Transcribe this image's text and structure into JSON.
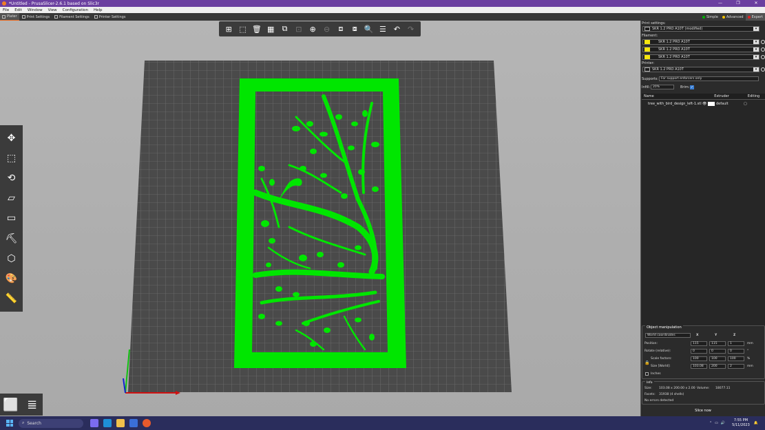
{
  "window": {
    "title": "*Untitled - PrusaSlicer-2.6.1 based on Slic3r",
    "controls": [
      "—",
      "❐",
      "✕"
    ]
  },
  "menu": [
    "File",
    "Edit",
    "Window",
    "View",
    "Configuration",
    "Help"
  ],
  "tabs": [
    {
      "label": "Plater",
      "active": true
    },
    {
      "label": "Print Settings"
    },
    {
      "label": "Filament Settings"
    },
    {
      "label": "Printer Settings"
    }
  ],
  "modes": [
    {
      "label": "Simple",
      "color": "#00b000"
    },
    {
      "label": "Advanced",
      "color": "#f0c000"
    },
    {
      "label": "Expert",
      "color": "#e02020"
    }
  ],
  "top_toolbar_icons": [
    "add-icon",
    "delete-icon",
    "delete-all-icon",
    "arrange-icon",
    "copy-icon",
    "paste-icon",
    "add-instance-icon",
    "remove-instance-icon",
    "split-objects-icon",
    "split-parts-icon",
    "search-icon",
    "layers-icon",
    "undo-icon",
    "redo-icon"
  ],
  "left_toolbar_icons": [
    "move-icon",
    "scale-icon",
    "rotate-icon",
    "place-on-face-icon",
    "cut-icon",
    "support-paint-icon",
    "seam-paint-icon",
    "mmu-paint-icon",
    "measure-icon"
  ],
  "sidebar": {
    "print_settings_label": "Print settings:",
    "print_profile": "SKR 1.2 PRO A10T (modified)",
    "filament_label": "Filament:",
    "filaments": [
      "SKR 1.2 PRO A10T",
      "SKR 1.2 PRO A10T",
      "SKR 1.2 PRO A10T"
    ],
    "filament_color": "#f6e60e",
    "printer_label": "Printer:",
    "printer_profile": "SKR 1.2 PRO A10T",
    "supports_label": "Supports:",
    "supports_value": "For support enforcers only",
    "infill_label": "Infill:",
    "infill_value": "20%",
    "brim_label": "Brim:",
    "object_list": {
      "headers": {
        "name": "Name",
        "extruder": "Extruder",
        "editing": "Editing"
      },
      "rows": [
        {
          "name": "tree_with_bird_design_left-1.stl",
          "extruder": "default"
        }
      ]
    },
    "object_manipulation": {
      "title": "Object manipulation",
      "coord_system": "World coordinates",
      "axes": [
        "X",
        "Y",
        "Z"
      ],
      "position_label": "Position:",
      "position": [
        "115",
        "115",
        "1"
      ],
      "position_unit": "mm",
      "rotate_label": "Rotate (relative):",
      "rotate": [
        "0",
        "0",
        "0"
      ],
      "rotate_unit": "°",
      "scale_label": "Scale factors:",
      "scale": [
        "100",
        "100",
        "100"
      ],
      "scale_unit": "%",
      "size_label": "Size [World]:",
      "size": [
        "103.08",
        "200",
        "2"
      ],
      "size_unit": "mm",
      "inches_label": "Inches"
    },
    "info": {
      "title": "Info",
      "size_label": "Size:",
      "size": "103.08 x 200.00 x 2.00",
      "volume_label": "Volume:",
      "volume": "18077.11",
      "facets_label": "Facets:",
      "facets": "31938 (4 shells)",
      "status": "No errors detected"
    },
    "slice_button": "Slice now"
  },
  "taskbar": {
    "search_placeholder": "Search",
    "time": "7:55 PM",
    "date": "5/11/2023"
  },
  "colors": {
    "model": "#00e600",
    "bed_dark": "#4a4a4a",
    "bed_grid": "#8a8a8a",
    "accent": "#ed6b21"
  }
}
